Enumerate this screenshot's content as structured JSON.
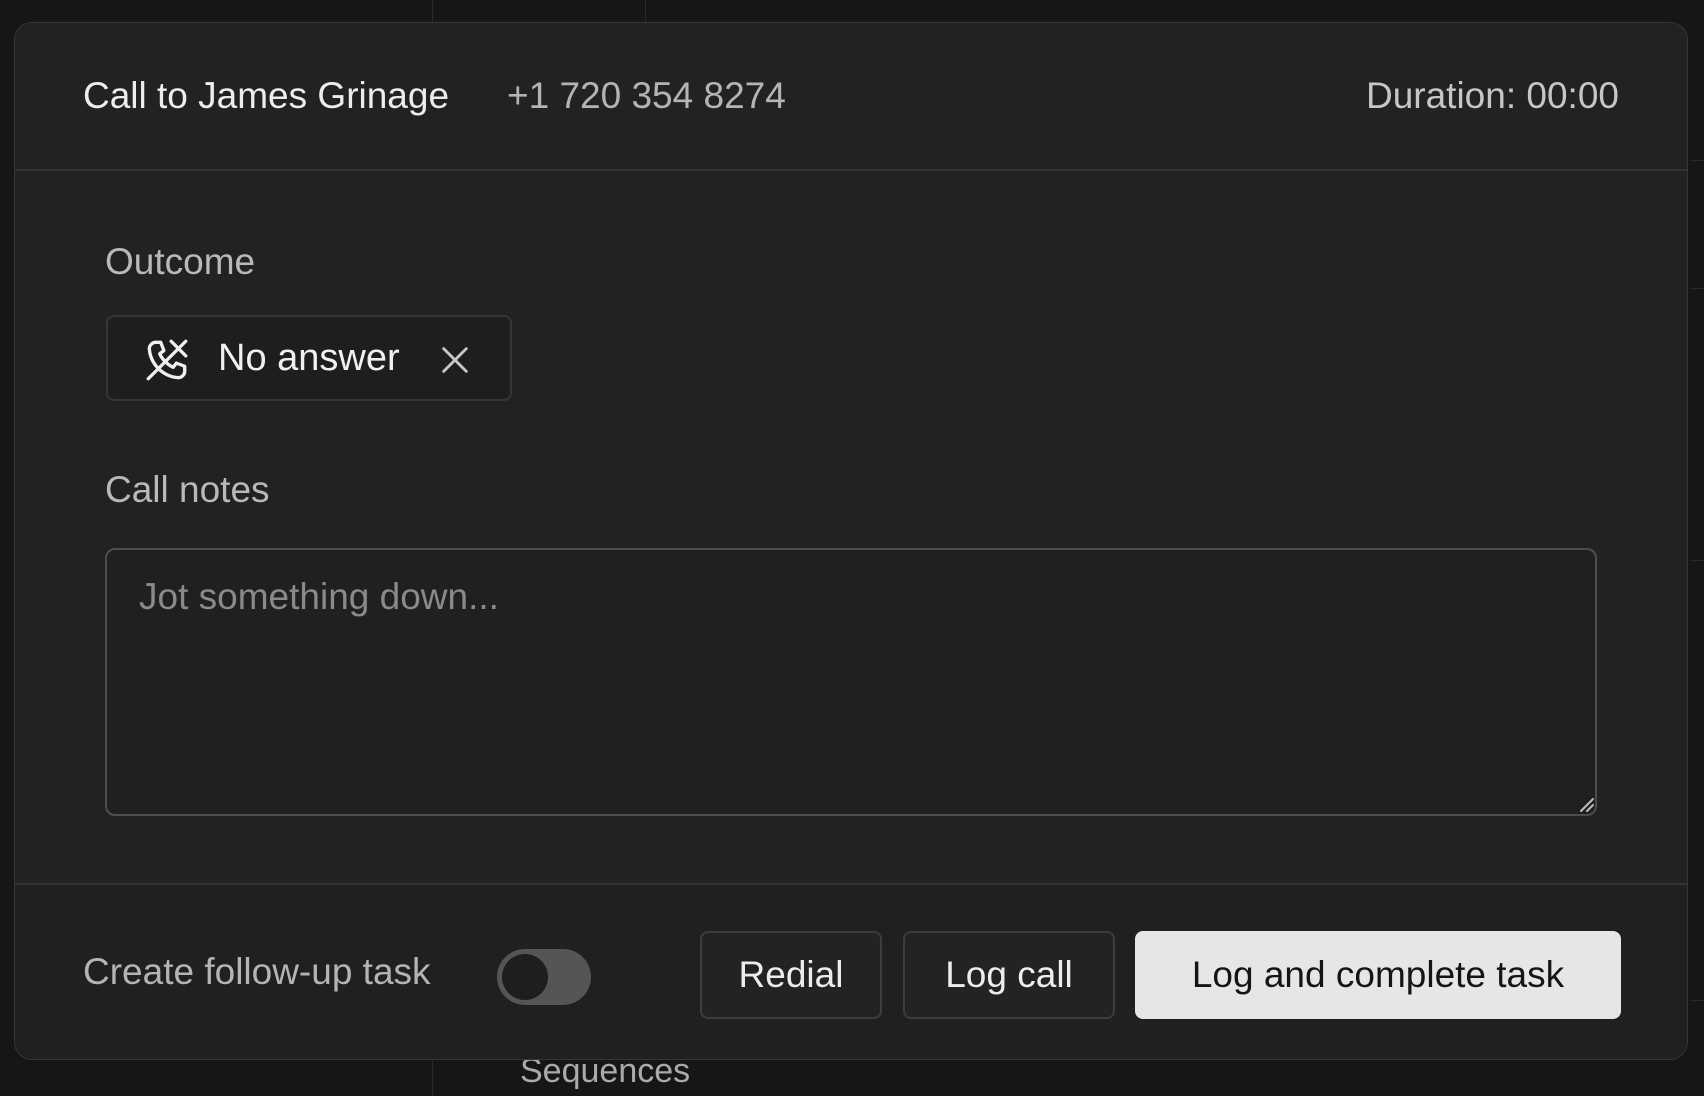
{
  "header": {
    "title": "Call to James Grinage",
    "phone": "+1 720 354 8274",
    "duration": "Duration: 00:00"
  },
  "outcome": {
    "label": "Outcome",
    "selected": "No answer",
    "icon": "phone-missed-icon"
  },
  "notes": {
    "label": "Call notes",
    "placeholder": "Jot something down...",
    "value": ""
  },
  "footer": {
    "followup_label": "Create follow-up task",
    "followup_enabled": false,
    "redial_label": "Redial",
    "log_call_label": "Log call",
    "log_complete_label": "Log and complete task"
  },
  "background": {
    "peek_text": "Sequences"
  },
  "colors": {
    "dialog_bg": "#222222",
    "primary_button_bg": "#e6e6e6",
    "toggle_off": "#555555"
  }
}
